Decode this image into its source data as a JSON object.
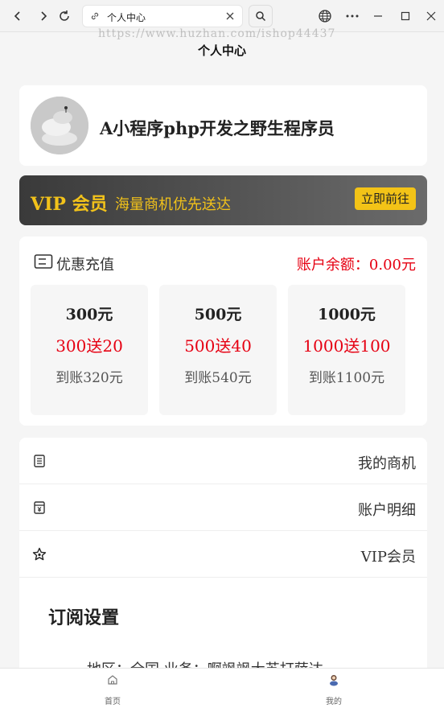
{
  "browser": {
    "tab_title": "个人中心",
    "watermark": "https://www.huzhan.com/ishop44437"
  },
  "page": {
    "title": "个人中心"
  },
  "profile": {
    "name": "A小程序php开发之野生程序员"
  },
  "vip_banner": {
    "title": "VIP 会员",
    "slogan": "海量商机优先送达",
    "button": "立即前往"
  },
  "recharge": {
    "title": "优惠充值",
    "balance": "账户余额：0.00元",
    "packages": [
      {
        "amount": "300元",
        "bonus": "300送20",
        "arrive": "到账320元"
      },
      {
        "amount": "500元",
        "bonus": "500送40",
        "arrive": "到账540元"
      },
      {
        "amount": "1000元",
        "bonus": "1000送100",
        "arrive": "到账1100元"
      }
    ]
  },
  "menu": {
    "items": [
      {
        "label": "我的商机",
        "icon": "list-icon"
      },
      {
        "label": "账户明细",
        "icon": "receipt-icon"
      },
      {
        "label": "VIP会员",
        "icon": "star-icon"
      }
    ]
  },
  "subscription": {
    "title": "订阅设置",
    "line": "地区：全国    业务：啊飒飒大苏打萨达"
  },
  "tabbar": {
    "items": [
      {
        "label": "首页",
        "icon": "home-icon"
      },
      {
        "label": "我的",
        "icon": "user-icon"
      }
    ]
  },
  "colors": {
    "accent_red": "#e60012",
    "vip_gold": "#f2c21a",
    "vip_button": "#f3c317"
  }
}
